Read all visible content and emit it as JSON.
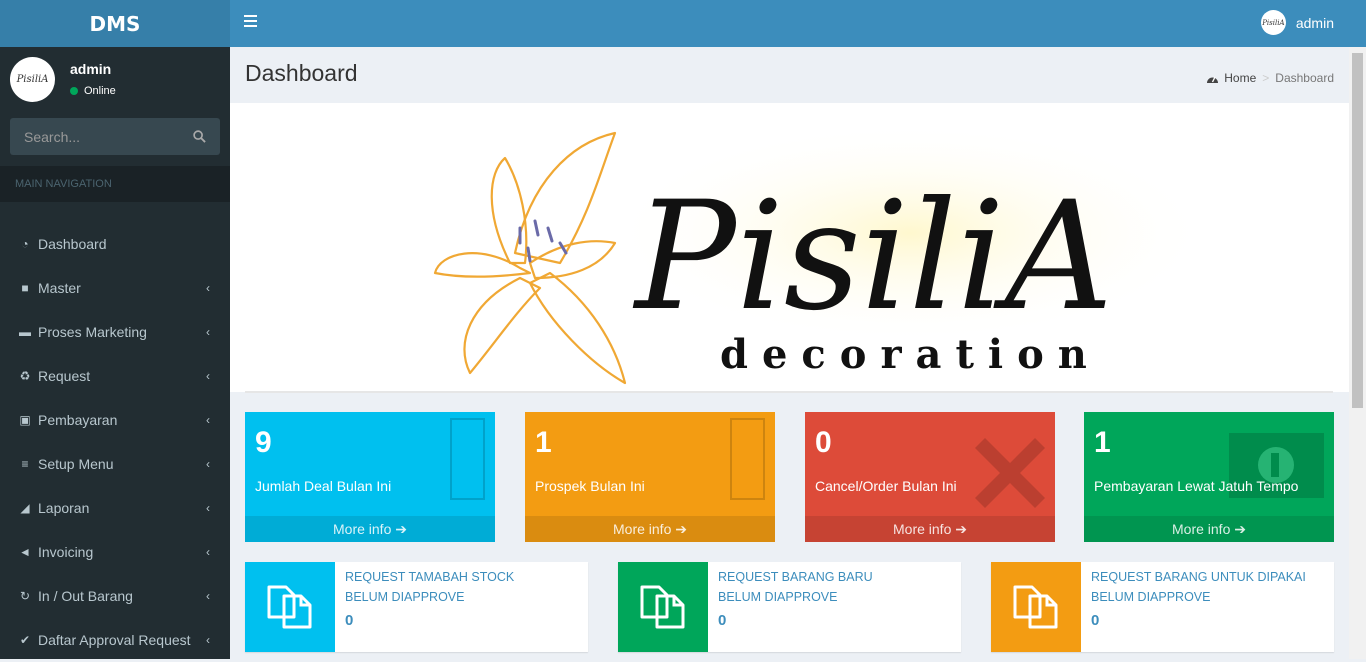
{
  "app": {
    "logo": "DMS"
  },
  "topbar": {
    "username": "admin"
  },
  "user_panel": {
    "name": "admin",
    "status": "Online"
  },
  "search": {
    "placeholder": "Search..."
  },
  "nav": {
    "header": "MAIN NAVIGATION",
    "items": [
      {
        "label": "Dashboard",
        "icon": "dashboard-icon",
        "has_children": false
      },
      {
        "label": "Master",
        "icon": "briefcase-icon",
        "has_children": true
      },
      {
        "label": "Proses Marketing",
        "icon": "cart-icon",
        "has_children": true
      },
      {
        "label": "Request",
        "icon": "recycle-icon",
        "has_children": true
      },
      {
        "label": "Pembayaran",
        "icon": "money-icon",
        "has_children": true
      },
      {
        "label": "Setup Menu",
        "icon": "list-icon",
        "has_children": true
      },
      {
        "label": "Laporan",
        "icon": "area-chart-icon",
        "has_children": true
      },
      {
        "label": "Invoicing",
        "icon": "paper-plane-icon",
        "has_children": true
      },
      {
        "label": "In / Out Barang",
        "icon": "refresh-icon",
        "has_children": true
      },
      {
        "label": "Daftar Approval Request",
        "icon": "check-circle-icon",
        "has_children": true
      }
    ]
  },
  "page": {
    "title": "Dashboard",
    "breadcrumb": {
      "home": "Home",
      "current": "Dashboard"
    }
  },
  "banner": {
    "brand": "PisiliA",
    "tagline": "decoration"
  },
  "stats": [
    {
      "value": "9",
      "label": "Jumlah Deal Bulan Ini",
      "more": "More info",
      "color": "#00c0ef"
    },
    {
      "value": "1",
      "label": "Prospek Bulan Ini",
      "more": "More info",
      "color": "#f39c12"
    },
    {
      "value": "0",
      "label": "Cancel/Order Bulan Ini",
      "more": "More info",
      "color": "#dd4b39"
    },
    {
      "value": "1",
      "label": "Pembayaran Lewat Jatuh Tempo",
      "more": "More info",
      "color": "#00a65a"
    }
  ],
  "requests": [
    {
      "line1": "REQUEST TAMABAH STOCK",
      "line2": "BELUM DIAPPROVE",
      "count": "0",
      "color": "#00c0ef"
    },
    {
      "line1": "REQUEST BARANG BARU",
      "line2": "BELUM DIAPPROVE",
      "count": "0",
      "color": "#00a65a"
    },
    {
      "line1": "REQUEST BARANG UNTUK DIPAKAI",
      "line2": "BELUM DIAPPROVE",
      "count": "0",
      "color": "#f39c12"
    }
  ]
}
